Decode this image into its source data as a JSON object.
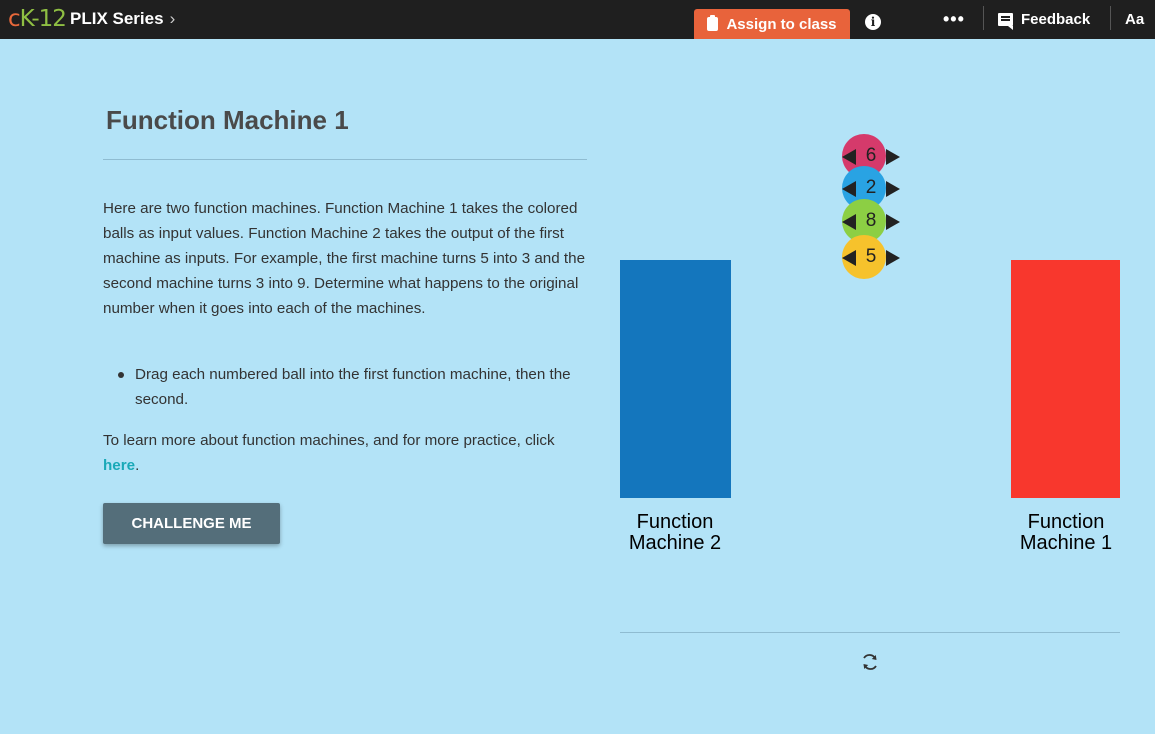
{
  "topbar": {
    "logo_c": "c",
    "logo_k": "K-12",
    "series": "PLIX Series",
    "series_chevron": "›",
    "assign_label": "Assign to class",
    "info_icon": "i",
    "more_icon": "•••",
    "feedback_label": "Feedback",
    "font_label": "Aa"
  },
  "content": {
    "title": "Function Machine 1",
    "description": "Here are two function machines. Function Machine 1 takes the colored balls as input values. Function Machine 2 takes the output of the first machine as inputs. For example, the first machine turns 5 into 3 and the second machine turns 3 into 9. Determine what happens to the original number when it goes into each of the machines.",
    "bullet": "Drag each numbered ball into the first function machine, then the second.",
    "learn_prefix": "To learn more about function machines, and for more practice, click ",
    "learn_link": "here",
    "learn_suffix": ".",
    "challenge_label": "CHALLENGE ME"
  },
  "interactive": {
    "machine_left_label_1": "Function",
    "machine_left_label_2": "Machine 2",
    "machine_right_label_1": "Function",
    "machine_right_label_2": "Machine 1",
    "balls": [
      {
        "value": "6",
        "color": "#d53a6b"
      },
      {
        "value": "2",
        "color": "#29a3e3"
      },
      {
        "value": "8",
        "color": "#8ccf44"
      },
      {
        "value": "5",
        "color": "#f6c22c"
      }
    ]
  },
  "colors": {
    "background": "#b3e3f7",
    "topbar": "#1f1f1f",
    "assign": "#e8633b",
    "machine_2": "#1476bd",
    "machine_1": "#f8372d",
    "challenge": "#546e7a",
    "link": "#1aa9b8"
  }
}
